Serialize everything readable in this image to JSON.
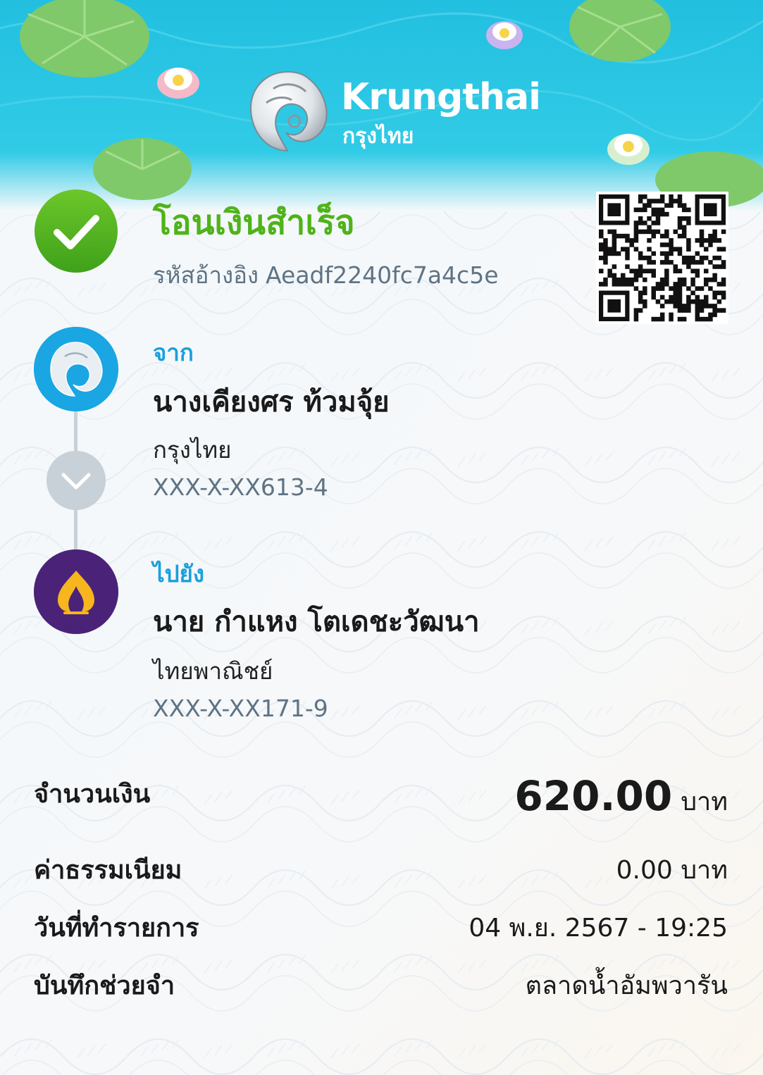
{
  "brand": {
    "name": "Krungthai",
    "name_thai": "กรุงไทย"
  },
  "status": {
    "title": "โอนเงินสำเร็จ",
    "reference_label": "รหัสอ้างอิง",
    "reference_code": "Aeadf2240fc7a4c5e"
  },
  "from": {
    "label": "จาก",
    "name": "นางเคียงศร ท้วมจุ้ย",
    "bank": "กรุงไทย",
    "account": "XXX-X-XX613-4"
  },
  "to": {
    "label": "ไปยัง",
    "name": "นาย กำแหง โตเดชะวัฒนา",
    "bank": "ไทยพาณิชย์",
    "account": "XXX-X-XX171-9"
  },
  "details": {
    "amount_label": "จำนวนเงิน",
    "amount_value": "620.00",
    "amount_unit": "บาท",
    "fee_label": "ค่าธรรมเนียม",
    "fee_value": "0.00 บาท",
    "date_label": "วันที่ทำรายการ",
    "date_value": "04 พ.ย. 2567 - 19:25",
    "memo_label": "บันทึกช่วยจำ",
    "memo_value": "ตลาดน้ำอัมพวารัน"
  },
  "colors": {
    "header_sky": "#22c0e0",
    "success_green": "#4fb319",
    "accent_blue": "#1ba0dc",
    "scb_purple": "#4a2379"
  },
  "icons": {
    "status": "check-circle-icon",
    "from_bank": "krungthai-logo-icon",
    "to_bank": "scb-logo-icon",
    "connector": "chevron-down-icon"
  }
}
